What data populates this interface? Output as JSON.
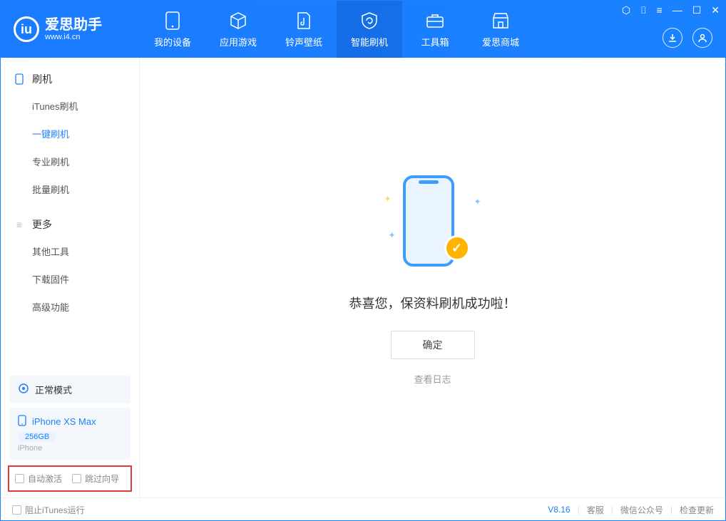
{
  "app": {
    "title": "爱思助手",
    "url": "www.i4.cn"
  },
  "nav": {
    "items": [
      {
        "label": "我的设备"
      },
      {
        "label": "应用游戏"
      },
      {
        "label": "铃声壁纸"
      },
      {
        "label": "智能刷机"
      },
      {
        "label": "工具箱"
      },
      {
        "label": "爱思商城"
      }
    ]
  },
  "sidebar": {
    "section1": {
      "title": "刷机"
    },
    "items1": [
      {
        "label": "iTunes刷机"
      },
      {
        "label": "一键刷机"
      },
      {
        "label": "专业刷机"
      },
      {
        "label": "批量刷机"
      }
    ],
    "section2": {
      "title": "更多"
    },
    "items2": [
      {
        "label": "其他工具"
      },
      {
        "label": "下载固件"
      },
      {
        "label": "高级功能"
      }
    ]
  },
  "mode": {
    "label": "正常模式"
  },
  "device": {
    "name": "iPhone XS Max",
    "storage": "256GB",
    "type": "iPhone"
  },
  "options": {
    "auto_activate": "自动激活",
    "skip_guide": "跳过向导"
  },
  "main": {
    "success_msg": "恭喜您，保资料刷机成功啦！",
    "ok_btn": "确定",
    "log_link": "查看日志"
  },
  "footer": {
    "block_itunes": "阻止iTunes运行",
    "version": "V8.16",
    "links": [
      "客服",
      "微信公众号",
      "检查更新"
    ]
  }
}
